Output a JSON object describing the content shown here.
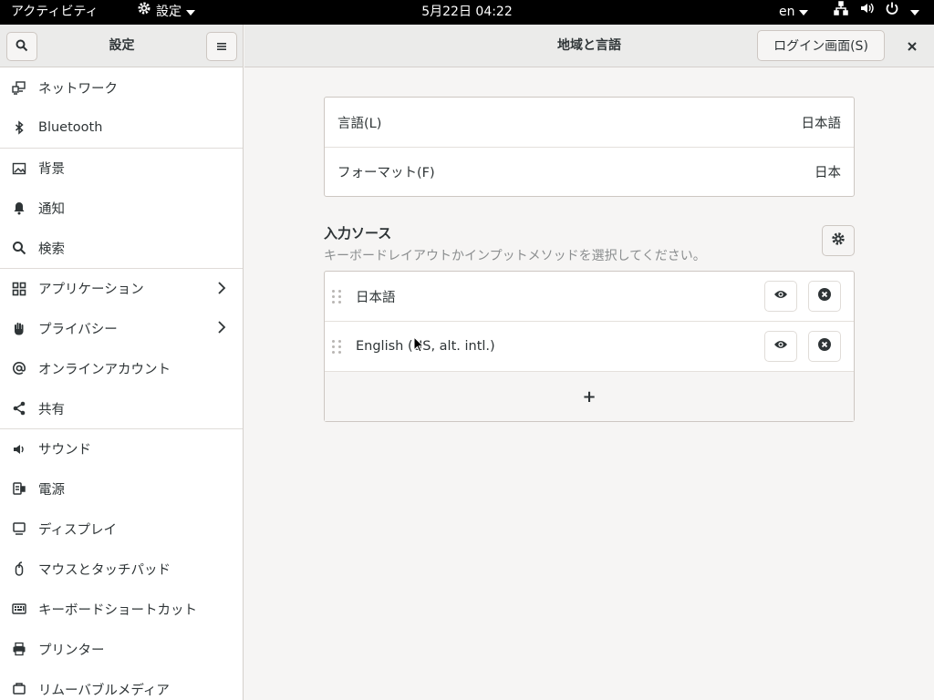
{
  "topbar": {
    "activities": "アクティビティ",
    "app_menu": "設定",
    "clock": "5月22日  04:22",
    "input_lang": "en",
    "icons": [
      "network-icon",
      "volume-icon",
      "power-icon",
      "chevron-down-icon"
    ]
  },
  "sidebar": {
    "title": "設定",
    "items": [
      {
        "label": "ネットワーク",
        "icon": "network-icon"
      },
      {
        "label": "Bluetooth",
        "icon": "bluetooth-icon"
      },
      {
        "label": "背景",
        "icon": "image-icon"
      },
      {
        "label": "通知",
        "icon": "bell-icon"
      },
      {
        "label": "検索",
        "icon": "search-icon"
      },
      {
        "label": "アプリケーション",
        "icon": "apps-icon"
      },
      {
        "label": "プライバシー",
        "icon": "hand-icon"
      },
      {
        "label": "オンラインアカウント",
        "icon": "at-icon"
      },
      {
        "label": "共有",
        "icon": "share-icon"
      },
      {
        "label": "サウンド",
        "icon": "speaker-icon"
      },
      {
        "label": "電源",
        "icon": "power-plug-icon"
      },
      {
        "label": "ディスプレイ",
        "icon": "display-icon"
      },
      {
        "label": "マウスとタッチパッド",
        "icon": "mouse-icon"
      },
      {
        "label": "キーボードショートカット",
        "icon": "keyboard-icon"
      },
      {
        "label": "プリンター",
        "icon": "printer-icon"
      },
      {
        "label": "リムーバブルメディア",
        "icon": "media-icon"
      }
    ]
  },
  "header": {
    "title": "地域と言語",
    "login_button": "ログイン画面(S)"
  },
  "language_section": {
    "rows": [
      {
        "label": "言語(L)",
        "value": "日本語"
      },
      {
        "label": "フォーマット(F)",
        "value": "日本"
      }
    ]
  },
  "input_sources": {
    "title": "入力ソース",
    "subtitle": "キーボードレイアウトかインプットメソッドを選択してください。",
    "sources": [
      {
        "name": "日本語"
      },
      {
        "name": "English (US, alt. intl.)"
      }
    ],
    "add_label": "+"
  },
  "colors": {
    "topbar_bg": "#000000",
    "window_bg": "#f6f5f4",
    "header_bg": "#ebebea",
    "text": "#2e3436",
    "muted_text": "#8b8e8f"
  }
}
